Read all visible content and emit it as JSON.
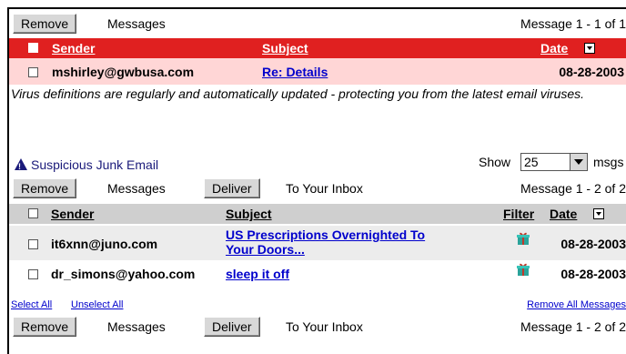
{
  "top_toolbar": {
    "remove_label": "Remove",
    "messages_label": "Messages",
    "message_range": "Message 1 - 1 of 1"
  },
  "inbox_header": {
    "sender": "Sender",
    "subject": "Subject",
    "date": "Date"
  },
  "inbox_rows": [
    {
      "sender": "mshirley@gwbusa.com",
      "subject": "Re: Details",
      "date": "08-28-2003"
    }
  ],
  "virus_notice": "Virus definitions are regularly and automatically updated - protecting you from the latest email viruses.",
  "junk": {
    "title": "Suspicious Junk Email",
    "show_label": "Show",
    "show_value": "25",
    "msgs_label": "msgs"
  },
  "junk_toolbar": {
    "remove_label": "Remove",
    "messages_label": "Messages",
    "deliver_label": "Deliver",
    "to_inbox_label": "To Your Inbox",
    "message_range": "Message 1 - 2 of 2"
  },
  "junk_header": {
    "sender": "Sender",
    "subject": "Subject",
    "filter": "Filter",
    "date": "Date"
  },
  "junk_rows": [
    {
      "sender": "it6xnn@juno.com",
      "subject_line1": "US Prescriptions Overnighted To",
      "subject_line2": "Your Doors...",
      "date": "08-28-2003"
    },
    {
      "sender": "dr_simons@yahoo.com",
      "subject": "sleep it off",
      "date": "08-28-2003"
    }
  ],
  "select_all": "Select All",
  "unselect_all": "Unselect All",
  "remove_all": "Remove All Messages",
  "bottom_toolbar": {
    "remove_label": "Remove",
    "messages_label": "Messages",
    "deliver_label": "Deliver",
    "to_inbox_label": "To Your Inbox",
    "message_range": "Message 1 - 2 of 2"
  }
}
